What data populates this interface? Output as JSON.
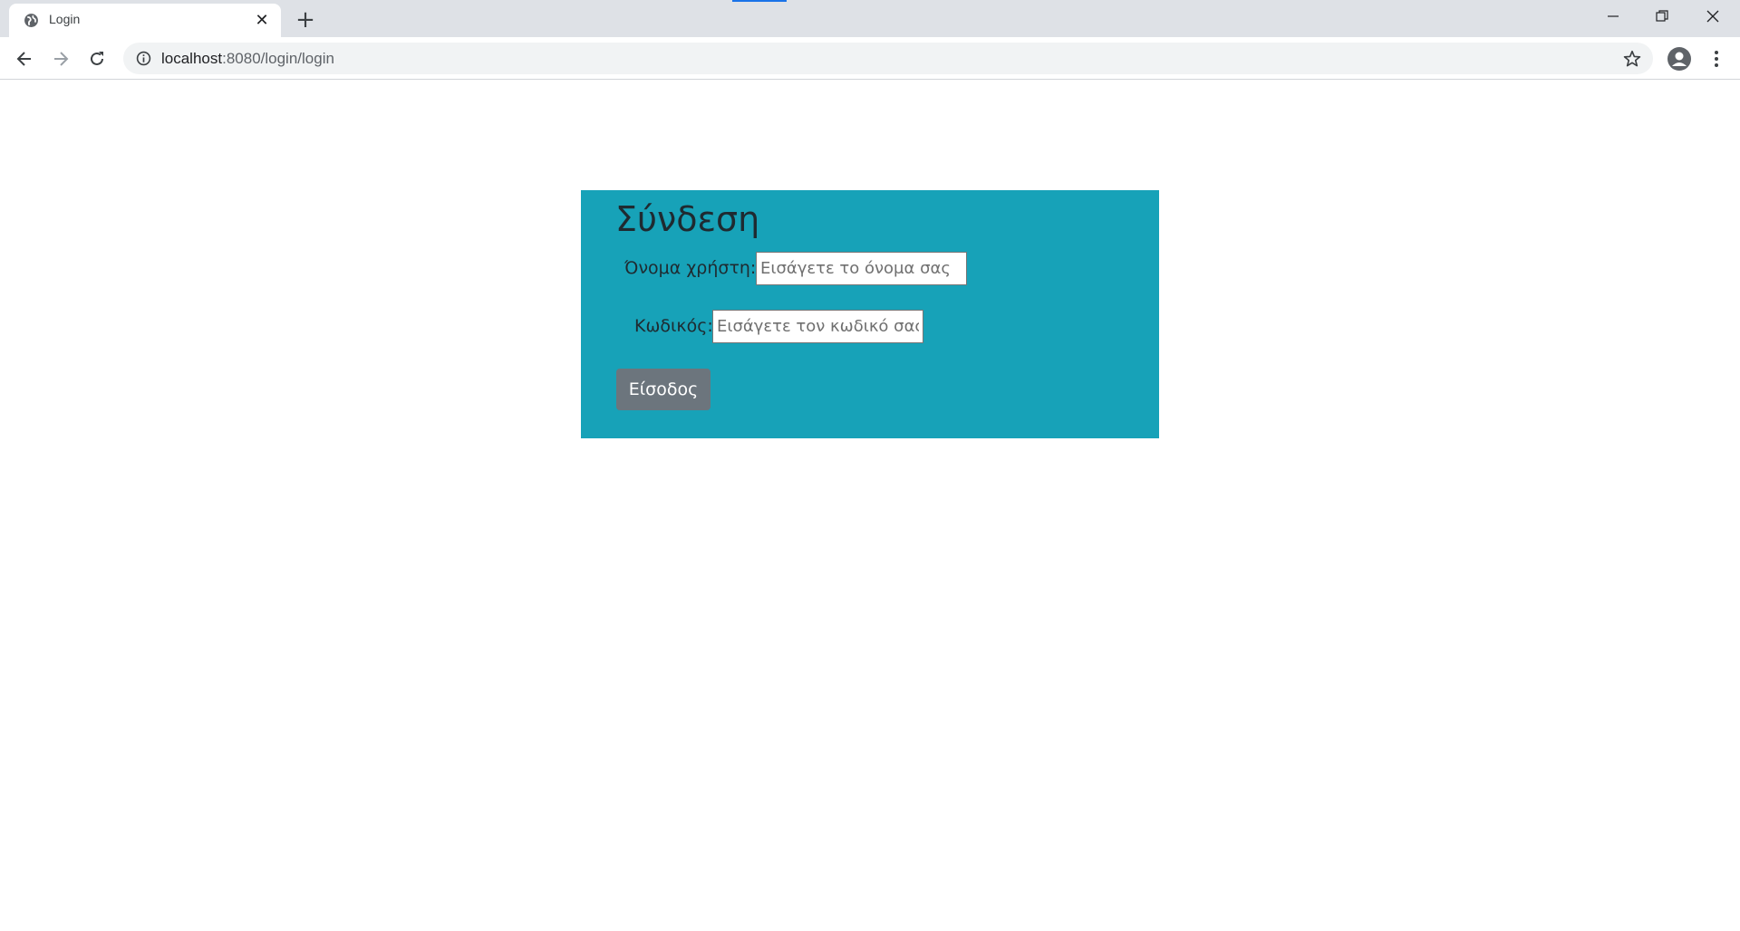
{
  "browser": {
    "tab_title": "Login",
    "url_host": "localhost",
    "url_path": ":8080/login/login"
  },
  "login": {
    "title": "Σύνδεση",
    "username_label": "Όνομα χρήστη:",
    "username_placeholder": "Εισάγετε το όνομα σας",
    "password_label": "Κωδικός:",
    "password_placeholder": "Εισάγετε τον κωδικό σας",
    "submit_label": "Είσοδος"
  },
  "colors": {
    "panel_background": "#17a2b8",
    "button_background": "#6c757d",
    "tabstrip_background": "#dee1e6"
  },
  "icons": {
    "tab_favicon": "globe-icon",
    "tab_close": "close-icon",
    "new_tab": "plus-icon",
    "back": "arrow-left-icon",
    "forward": "arrow-right-icon",
    "reload": "reload-icon",
    "site_info": "info-icon",
    "bookmark": "star-icon",
    "profile": "account-icon",
    "menu": "kebab-menu-icon",
    "minimize": "minimize-icon",
    "restore": "restore-icon",
    "close_window": "close-icon"
  }
}
